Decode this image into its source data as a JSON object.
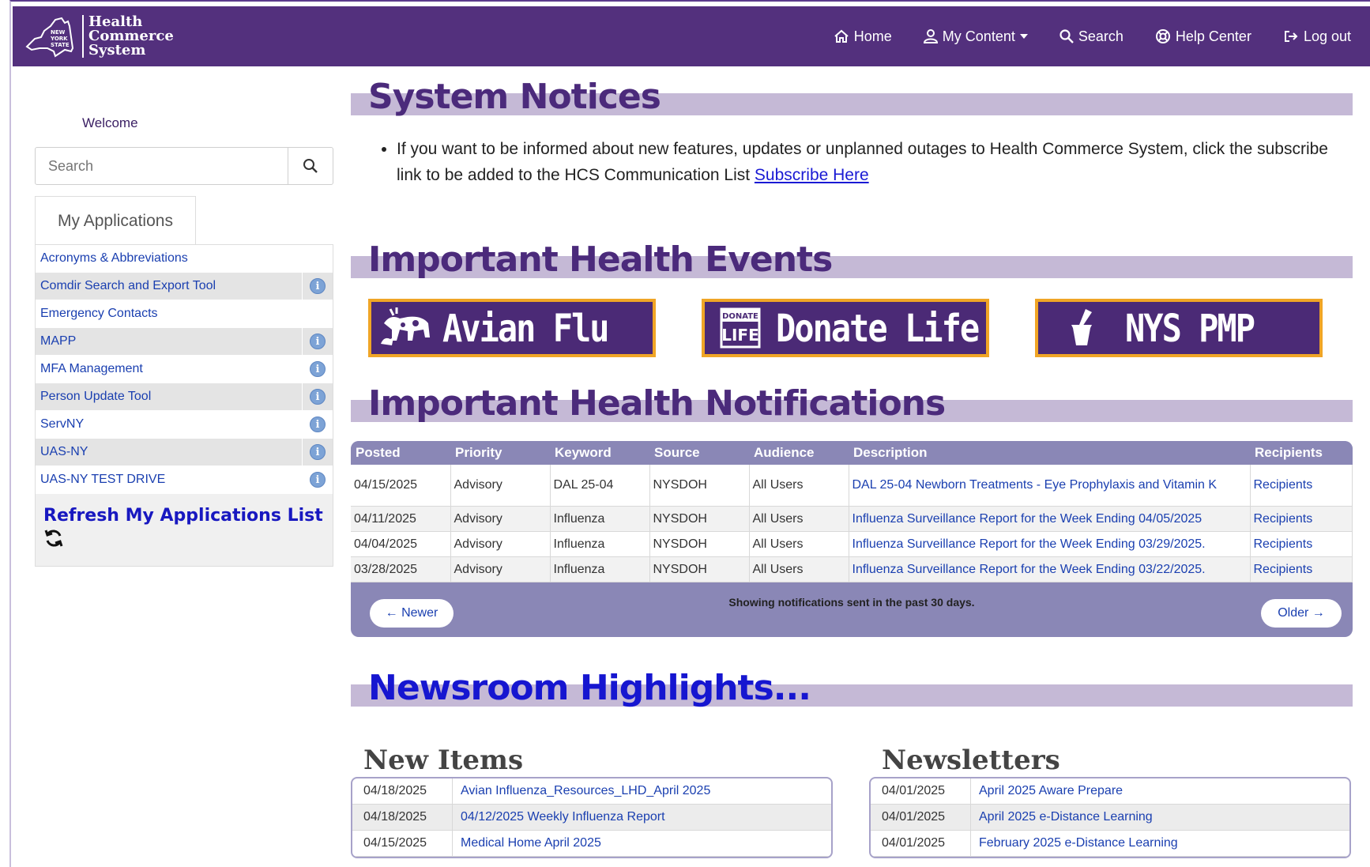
{
  "header": {
    "logo_state": "NEW YORK STATE",
    "logo_lines": [
      "Health",
      "Commerce",
      "System"
    ],
    "nav": [
      {
        "label": "Home",
        "icon": "home-icon"
      },
      {
        "label": "My Content",
        "icon": "user-icon"
      },
      {
        "label": "Search",
        "icon": "search-icon"
      },
      {
        "label": "Help Center",
        "icon": "help-icon"
      },
      {
        "label": "Log out",
        "icon": "logout-icon"
      }
    ]
  },
  "sidebar": {
    "welcome": "Welcome",
    "search_placeholder": "Search",
    "apps_tab": "My Applications",
    "apps": [
      {
        "name": "Acronyms & Abbreviations",
        "info": false
      },
      {
        "name": "Comdir Search and Export Tool",
        "info": true
      },
      {
        "name": "Emergency Contacts",
        "info": false
      },
      {
        "name": "MAPP",
        "info": true
      },
      {
        "name": "MFA Management",
        "info": true
      },
      {
        "name": "Person Update Tool",
        "info": true
      },
      {
        "name": "ServNY",
        "info": true
      },
      {
        "name": "UAS-NY",
        "info": true
      },
      {
        "name": "UAS-NY TEST DRIVE",
        "info": true
      }
    ],
    "refresh_label": "Refresh My Applications List"
  },
  "notices": {
    "title": "System Notices",
    "text": "If you want to be informed about new features, updates or unplanned outages to Health Commerce System, click the subscribe link to be added to the HCS Communication List",
    "link": "Subscribe Here"
  },
  "events": {
    "title": "Important Health Events",
    "banners": [
      {
        "label": "Avian Flu",
        "icon": "animals-icon"
      },
      {
        "label": "Donate Life",
        "icon": "donate-life-icon",
        "badge": [
          "DONATE",
          "LIFE"
        ]
      },
      {
        "label": "NYS PMP",
        "icon": "mortar-pestle-icon"
      }
    ]
  },
  "notifications": {
    "title": "Important Health Notifications",
    "columns": [
      "Posted",
      "Priority",
      "Keyword",
      "Source",
      "Audience",
      "Description",
      "Recipients"
    ],
    "rows": [
      [
        "04/15/2025",
        "Advisory",
        "DAL 25-04",
        "NYSDOH",
        "All Users",
        "DAL 25-04 Newborn Treatments - Eye Prophylaxis and Vitamin K",
        "Recipients"
      ],
      [
        "04/11/2025",
        "Advisory",
        "Influenza",
        "NYSDOH",
        "All Users",
        "Influenza Surveillance Report for the Week Ending 04/05/2025",
        "Recipients"
      ],
      [
        "04/04/2025",
        "Advisory",
        "Influenza",
        "NYSDOH",
        "All Users",
        "Influenza Surveillance Report for the Week Ending 03/29/2025.",
        "Recipients"
      ],
      [
        "03/28/2025",
        "Advisory",
        "Influenza",
        "NYSDOH",
        "All Users",
        "Influenza Surveillance Report for the Week Ending 03/22/2025.",
        "Recipients"
      ]
    ],
    "newer": "← Newer",
    "older": "Older →",
    "footer": "Showing notifications sent in the past 30 days."
  },
  "newsroom": {
    "title": "Newsroom Highlights...",
    "new_items_title": "New Items",
    "new_items": [
      {
        "date": "04/18/2025",
        "title": "Avian Influenza_Resources_LHD_April 2025"
      },
      {
        "date": "04/18/2025",
        "title": "04/12/2025 Weekly Influenza Report"
      },
      {
        "date": "04/15/2025",
        "title": "Medical Home April 2025"
      }
    ],
    "newsletters_title": "Newsletters",
    "newsletters": [
      {
        "date": "04/01/2025",
        "title": "April 2025 Aware Prepare"
      },
      {
        "date": "04/01/2025",
        "title": "April 2025 e-Distance Learning"
      },
      {
        "date": "04/01/2025",
        "title": "February 2025 e-Distance Learning"
      }
    ]
  },
  "colors": {
    "brand_purple": "#53307d",
    "band_lavender": "#c5b9d6",
    "banner_border": "#f0a526",
    "link_blue": "#1a3fb0",
    "table_header": "#8a87b6"
  }
}
